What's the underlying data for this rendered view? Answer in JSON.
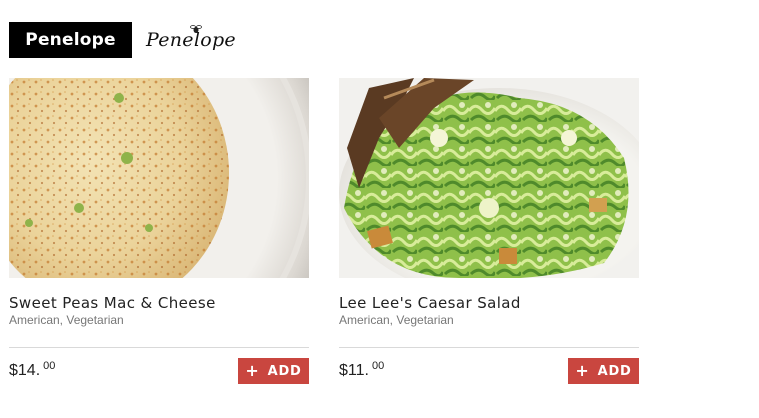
{
  "header": {
    "brand_badge": "Penelope",
    "brand_logo": "Penelope",
    "logo_icon": "bee-icon"
  },
  "menu_items": [
    {
      "title": "Sweet Peas Mac & Cheese",
      "tags": "American, Vegetarian",
      "price_whole": "$14.",
      "price_cents": "00",
      "add_label": "ADD",
      "add_icon": "plus-icon",
      "image": "mac-and-cheese-photo"
    },
    {
      "title": "Lee Lee's Caesar Salad",
      "tags": "American, Vegetarian",
      "price_whole": "$11.",
      "price_cents": "00",
      "add_label": "ADD",
      "add_icon": "plus-icon",
      "image": "caesar-salad-photo"
    }
  ],
  "colors": {
    "badge_bg": "#000000",
    "add_button_bg": "#c9463f",
    "divider": "#d9d9d9",
    "tags_text": "#777777"
  }
}
